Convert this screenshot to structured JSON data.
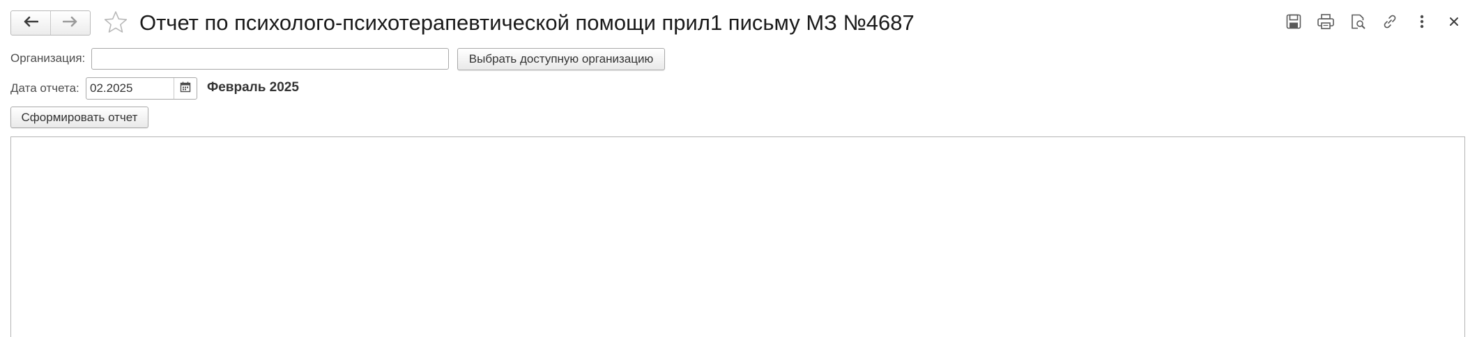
{
  "window": {
    "title": "Отчет по психолого-психотерапевтической помощи прил1 письму МЗ №4687",
    "icons": {
      "back": "arrow-left-icon",
      "forward": "arrow-right-icon",
      "favorite": "star-icon",
      "save": "save-icon",
      "print": "print-icon",
      "preview": "print-preview-icon",
      "link": "link-icon",
      "more": "more-vertical-icon",
      "close": "close-icon"
    }
  },
  "form": {
    "organization": {
      "label": "Организация:",
      "value": "",
      "select_button": "Выбрать доступную организацию"
    },
    "report_date": {
      "label": "Дата отчета:",
      "value": "02.2025",
      "period_text": "Февраль 2025",
      "calendar_icon": "calendar-icon"
    },
    "generate_button": "Сформировать отчет"
  },
  "report": {
    "content": ""
  },
  "colors": {
    "border": "#a8a8a8",
    "text": "#333333",
    "title": "#1a1a1a",
    "icon": "#5a5a5a"
  }
}
